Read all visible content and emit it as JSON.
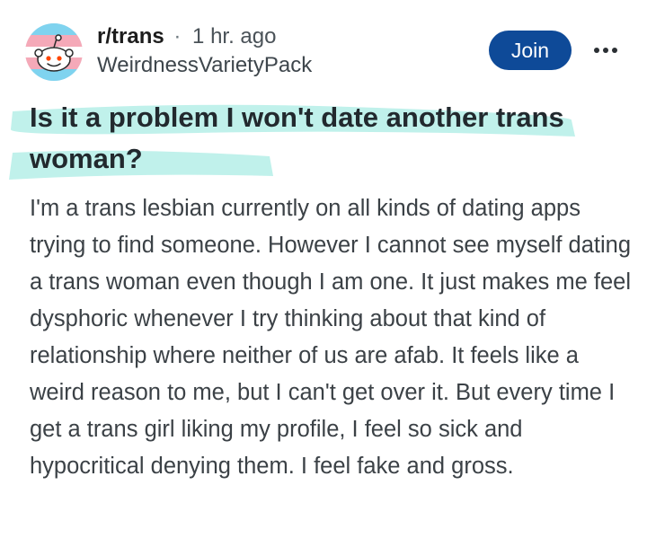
{
  "post": {
    "subreddit": "r/trans",
    "separator": "·",
    "time": "1 hr. ago",
    "author": "WeirdnessVarietyPack",
    "join_label": "Join",
    "more_label": "More options",
    "title": "Is it a problem I won't date another trans woman?",
    "body": "I'm a trans lesbian currently on all kinds of dating apps trying to find someone. However I cannot see myself dating a trans woman even though I am one. It just makes me feel dysphoric whenever I try thinking about that kind of relationship where neither of us are afab. It feels like a weird reason to me, but I can't get over it. But every time I get a trans girl liking my profile, I feel so sick and hypocritical denying them. I feel fake and gross."
  },
  "icons": {
    "avatar": "subreddit-avatar-icon",
    "more": "more-dots-icon"
  },
  "colors": {
    "join_button": "#0e4a98",
    "highlight": "#b9efe9",
    "trans_blue": "#7fd3ef",
    "trans_pink": "#f5a9b8",
    "trans_white": "#ffffff"
  }
}
